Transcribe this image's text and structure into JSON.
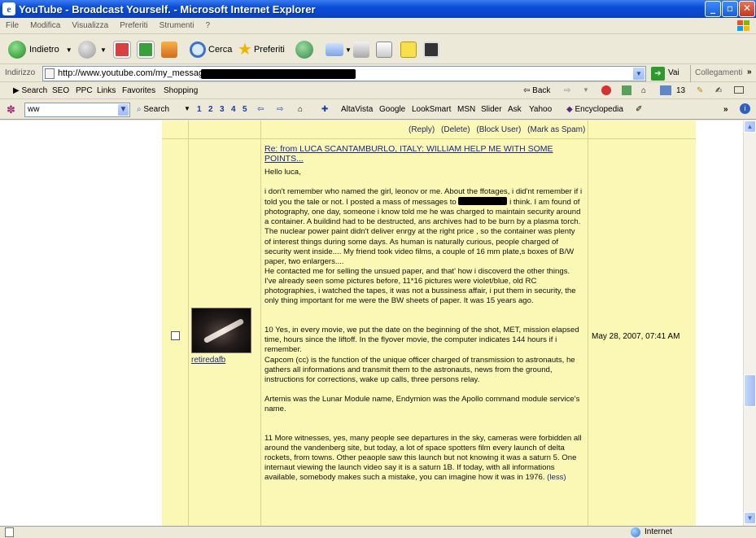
{
  "window": {
    "title": "YouTube - Broadcast Yourself. - Microsoft Internet Explorer"
  },
  "menu": [
    "File",
    "Modifica",
    "Visualizza",
    "Preferiti",
    "Strumenti",
    "?"
  ],
  "toolbar": {
    "back_label": "Indietro",
    "search_label": "Cerca",
    "favorites_label": "Preferiti"
  },
  "address": {
    "label": "Indirizzo",
    "url": "http://www.youtube.com/my_message",
    "go_label": "Vai",
    "links_label": "Collegamenti"
  },
  "links_bar": {
    "search": "Search",
    "items": [
      "SEO",
      "PPC",
      "Links",
      "Favorites",
      "Shopping"
    ],
    "back": "Back",
    "count": "13"
  },
  "search_bar": {
    "query": "ww",
    "search_label": "Search",
    "pages": [
      "1",
      "2",
      "3",
      "4",
      "5"
    ],
    "engines": [
      "AltaVista",
      "Google",
      "LookSmart",
      "MSN",
      "Slider",
      "Ask",
      "Yahoo"
    ],
    "encyclopedia": "Encyclopedia"
  },
  "message_actions": [
    "(Reply)",
    "(Delete)",
    "(Block User)",
    "(Mark as Spam)"
  ],
  "message": {
    "subject": "Re: from LUCA SCANTAMBURLO, ITALY: WILLIAM HELP ME WITH SOME POINTS...",
    "sender": "retiredafb",
    "date": "May 28, 2007, 07:41 AM",
    "greeting": "Hello luca,",
    "para1a": "i don't remember who named the girl, leonov or me. About the ffotages, i did'nt remember if i told you the tale or not. I posted a mass of messages to",
    "para1b": "i think. I am found of photography, one day, someone i know told me he was charged to maintain security around a container. A buildind had to be destructed, ans archives had to be burn by a plasma torch.\nThe nuclear power paint didn't deliver enrgy at the right price , so the container was plenty of interest things during some days. As human is naturally curious, people charged of security went inside.... My friend took video films, a couple of 16 mm plate,s boxes of B/W paper, two enlargers....\nHe contacted me for selling the unsued paper, and that' how i discoverd the other things. I've already seen some pictures before, 11*16 pictures were violet/blue, old RC photographies, i watched the tapes, it was not a bussiness affair, i put them in security, the only thing important for me were the BW sheets of paper. It was 15 years ago.",
    "para2": "10 Yes, in every movie, we put the date on the beginning of the shot, MET, mission elapsed time, hours since the liftoff. In the flyover movie, the computer indicates 144 hours if i remember.\nCapcom (cc) is the function of the unique officer charged of transmission to astronauts, he gathers all informations and transmit them to the astronauts, news from the ground, instructions for corrections, wake up calls, three persons relay.",
    "para3": "Artemis was the Lunar Module name, Endymion was the Apollo command module service's name.",
    "para4": "11 More witnesses, yes, many people see departures in the sky, cameras were forbidden all around the vandenberg site, but today, a lot of space spotters film every launch of delta rockets, from towns. Other peaople saw this launch but not knowing it was a saturn 5. One internaut viewing the launch video say it is a saturn 1B. If today, with all informations available, somebody makes such a mistake, you can imagine how it was in 1976.",
    "less": "(less)"
  },
  "status": {
    "zone": "Internet"
  }
}
